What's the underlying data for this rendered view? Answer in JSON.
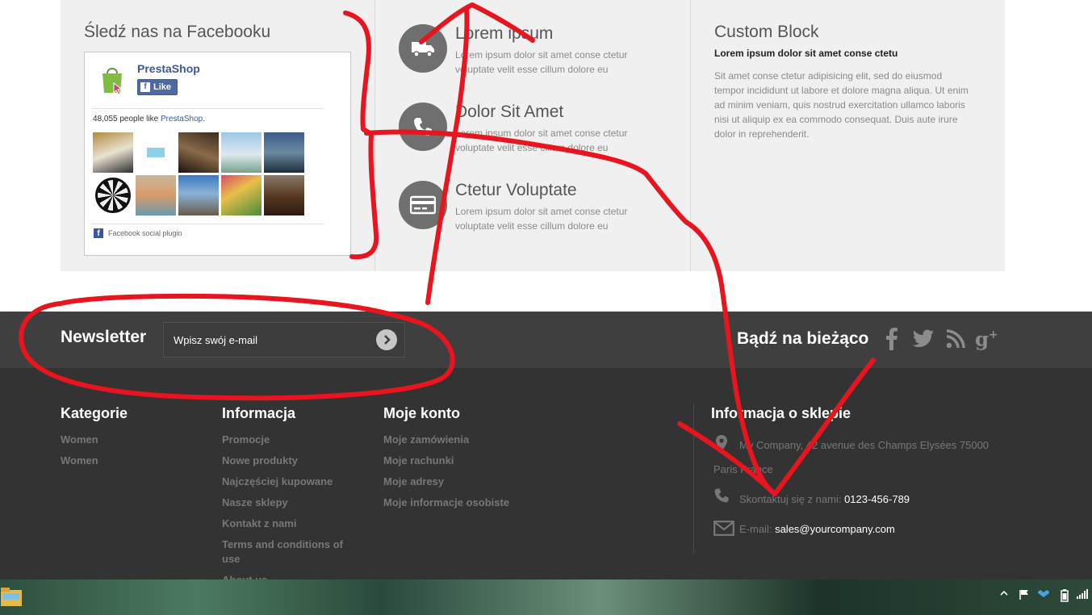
{
  "facebook": {
    "title": "Śledź nas na Facebooku",
    "page_name": "PrestaShop",
    "like_label": "Like",
    "likes_count": "48,055 people like",
    "likes_page": "PrestaShop",
    "likes_suffix": ".",
    "plugin_label": "Facebook social plugin"
  },
  "features": [
    {
      "icon": "truck-icon",
      "title": "Lorem ipsum",
      "desc": "Lorem ipsum dolor sit amet conse ctetur voluptate velit esse cillum dolore eu"
    },
    {
      "icon": "phone-icon",
      "title": "Dolor Sit Amet",
      "desc": "Lorem ipsum dolor sit amet conse ctetur voluptate velit esse cillum dolore eu"
    },
    {
      "icon": "credit-card-icon",
      "title": "Ctetur Voluptate",
      "desc": "Lorem ipsum dolor sit amet conse ctetur voluptate velit esse cillum dolore eu"
    }
  ],
  "custom_block": {
    "title": "Custom Block",
    "subtitle": "Lorem ipsum dolor sit amet conse ctetu",
    "body": "Sit amet conse ctetur adipisicing elit, sed do eiusmod tempor incididunt ut labore et dolore magna aliqua. Ut enim ad minim veniam, quis nostrud exercitation ullamco laboris nisi ut aliquip ex ea commodo consequat. Duis aute irure dolor in reprehenderit."
  },
  "newsletter": {
    "title": "Newsletter",
    "placeholder": "Wpisz swój e-mail"
  },
  "social": {
    "title": "Bądź na bieżąco",
    "icons": [
      "facebook-icon",
      "twitter-icon",
      "rss-icon",
      "google-plus-icon"
    ]
  },
  "footer": {
    "categories": {
      "title": "Kategorie",
      "items": [
        "Women",
        "Women"
      ]
    },
    "information": {
      "title": "Informacja",
      "items": [
        "Promocje",
        "Nowe produkty",
        "Najczęściej kupowane",
        "Nasze sklepy",
        "Kontakt z nami",
        "Terms and conditions of use",
        "About us"
      ]
    },
    "account": {
      "title": "Moje konto",
      "items": [
        "Moje zamówienia",
        "Moje rachunki",
        "Moje adresy",
        "Moje informacje osobiste"
      ]
    },
    "store": {
      "title": "Informacja o sklepie",
      "address_line1": "My Company, 42 avenue des Champs Elysées 75000",
      "address_line2": "Paris France",
      "phone_label": "Skontaktuj się z nami:",
      "phone": "0123-456-789",
      "email_label": "E-mail:",
      "email": "sales@yourcompany.com"
    }
  },
  "colors": {
    "annotation": "#e8141e",
    "footer_bg": "#333333",
    "newsletter_bg": "#3f3f3f",
    "panel_bg": "#f0f0f0"
  }
}
